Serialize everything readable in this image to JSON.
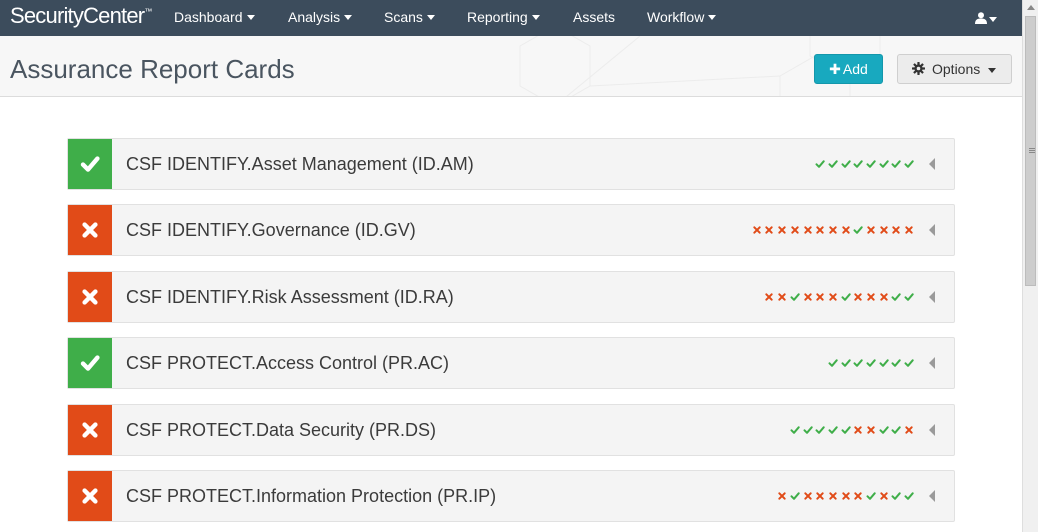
{
  "brand": {
    "name": "SecurityCenter",
    "mark": "™"
  },
  "nav": {
    "items": [
      {
        "label": "Dashboard",
        "dropdown": true
      },
      {
        "label": "Analysis",
        "dropdown": true
      },
      {
        "label": "Scans",
        "dropdown": true
      },
      {
        "label": "Reporting",
        "dropdown": true
      },
      {
        "label": "Assets",
        "dropdown": false
      },
      {
        "label": "Workflow",
        "dropdown": true
      }
    ],
    "user_icon": "user-icon"
  },
  "header": {
    "title": "Assurance Report Cards",
    "add_button": {
      "icon": "plus-icon",
      "label": "Add"
    },
    "options_button": {
      "icon": "gear-icon",
      "label": "Options"
    }
  },
  "cards": [
    {
      "title": "CSF IDENTIFY.Asset Management (ID.AM)",
      "status": "pass",
      "history": [
        "pass",
        "pass",
        "pass",
        "pass",
        "pass",
        "pass",
        "pass",
        "pass"
      ]
    },
    {
      "title": "CSF IDENTIFY.Governance (ID.GV)",
      "status": "fail",
      "history": [
        "fail",
        "fail",
        "fail",
        "fail",
        "fail",
        "fail",
        "fail",
        "fail",
        "pass",
        "fail",
        "fail",
        "fail",
        "fail"
      ]
    },
    {
      "title": "CSF IDENTIFY.Risk Assessment (ID.RA)",
      "status": "fail",
      "history": [
        "fail",
        "fail",
        "pass",
        "fail",
        "fail",
        "fail",
        "pass",
        "fail",
        "fail",
        "fail",
        "pass",
        "pass"
      ]
    },
    {
      "title": "CSF PROTECT.Access Control (PR.AC)",
      "status": "pass",
      "history": [
        "pass",
        "pass",
        "pass",
        "pass",
        "pass",
        "pass",
        "pass"
      ]
    },
    {
      "title": "CSF PROTECT.Data Security (PR.DS)",
      "status": "fail",
      "history": [
        "pass",
        "pass",
        "pass",
        "pass",
        "pass",
        "fail",
        "fail",
        "pass",
        "pass",
        "fail"
      ]
    },
    {
      "title": "CSF PROTECT.Information Protection (PR.IP)",
      "status": "fail",
      "history": [
        "fail",
        "pass",
        "fail",
        "fail",
        "fail",
        "fail",
        "fail",
        "pass",
        "fail",
        "pass",
        "pass"
      ]
    }
  ],
  "colors": {
    "pass": "#3fae49",
    "fail": "#e14b18",
    "nav_bg": "#3c4c5c",
    "accent": "#18a9bf"
  }
}
